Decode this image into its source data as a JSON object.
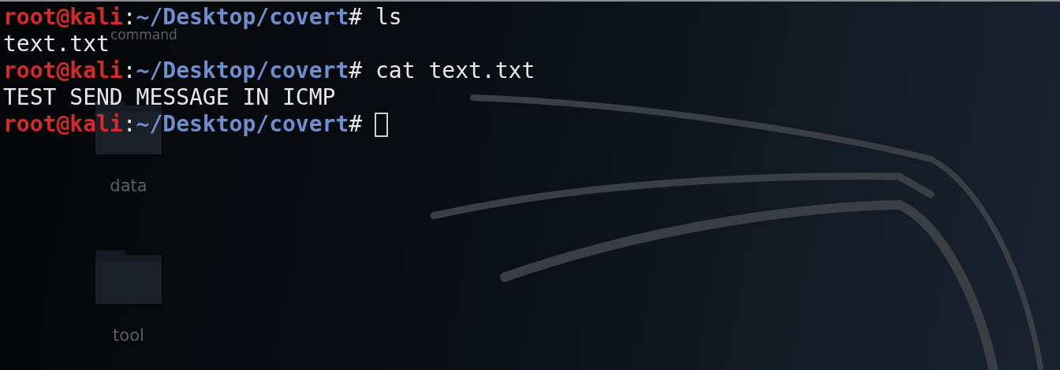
{
  "desktop": {
    "icons": [
      {
        "label": "command"
      },
      {
        "label": "data"
      },
      {
        "label": "tool"
      }
    ]
  },
  "terminal": {
    "lines": [
      {
        "kind": "prompt",
        "user_host": "root@kali",
        "separator": ":",
        "path": "~/Desktop/covert",
        "symbol": "#",
        "command": " ls"
      },
      {
        "kind": "output",
        "text": "text.txt"
      },
      {
        "kind": "prompt",
        "user_host": "root@kali",
        "separator": ":",
        "path": "~/Desktop/covert",
        "symbol": "#",
        "command": " cat text.txt"
      },
      {
        "kind": "output",
        "text": "TEST SEND MESSAGE IN ICMP"
      },
      {
        "kind": "prompt",
        "user_host": "root@kali",
        "separator": ":",
        "path": "~/Desktop/covert",
        "symbol": "#",
        "cursor": true
      }
    ]
  }
}
